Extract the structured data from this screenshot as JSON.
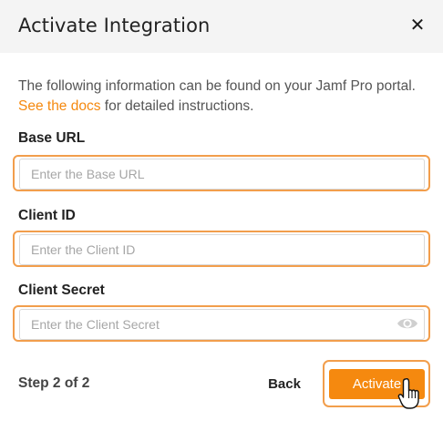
{
  "dialog": {
    "title": "Activate Integration",
    "close_label": "✕"
  },
  "intro": {
    "text_before": "The following information can be found on your Jamf Pro portal. ",
    "link_text": "See the docs",
    "text_after": " for detailed instructions."
  },
  "fields": {
    "base_url": {
      "label": "Base URL",
      "placeholder": "Enter the Base URL",
      "value": ""
    },
    "client_id": {
      "label": "Client ID",
      "placeholder": "Enter the Client ID",
      "value": ""
    },
    "client_secret": {
      "label": "Client Secret",
      "placeholder": "Enter the Client Secret",
      "value": "",
      "visibility_icon": "eye-icon"
    }
  },
  "footer": {
    "step_text": "Step 2 of 2",
    "back_label": "Back",
    "activate_label": "Activate"
  },
  "colors": {
    "accent": "#f5890f",
    "highlight": "#f29e4c",
    "header_bg": "#f4f4f4"
  },
  "cursor": {
    "icon": "hand-pointer-icon"
  }
}
